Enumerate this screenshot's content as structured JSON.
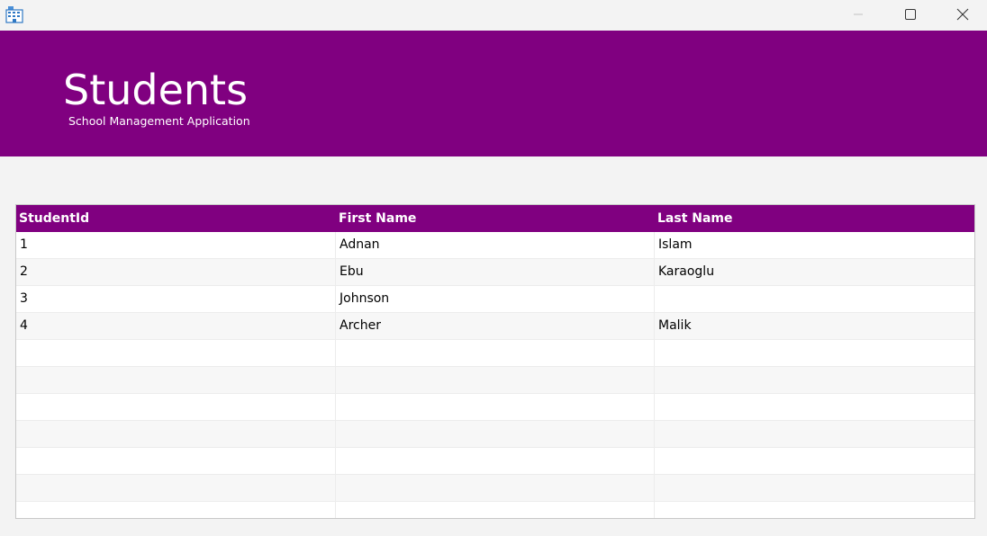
{
  "colors": {
    "accent": "#800080",
    "header_text": "#ffffff"
  },
  "titlebar": {
    "app_icon": "building-icon",
    "minimize_icon": "minimize-icon",
    "maximize_icon": "maximize-icon",
    "close_icon": "close-icon"
  },
  "header": {
    "title": "Students",
    "subtitle": "School Management Application"
  },
  "table": {
    "columns": [
      "StudentId",
      "First Name",
      "Last Name"
    ],
    "rows": [
      [
        "1",
        "Adnan",
        "Islam"
      ],
      [
        "2",
        "Ebu",
        "Karaoglu"
      ],
      [
        "3",
        "Johnson",
        ""
      ],
      [
        "4",
        "Archer",
        "Malik"
      ],
      [
        "",
        "",
        ""
      ],
      [
        "",
        "",
        ""
      ],
      [
        "",
        "",
        ""
      ],
      [
        "",
        "",
        ""
      ],
      [
        "",
        "",
        ""
      ],
      [
        "",
        "",
        ""
      ],
      [
        "",
        "",
        ""
      ]
    ]
  }
}
